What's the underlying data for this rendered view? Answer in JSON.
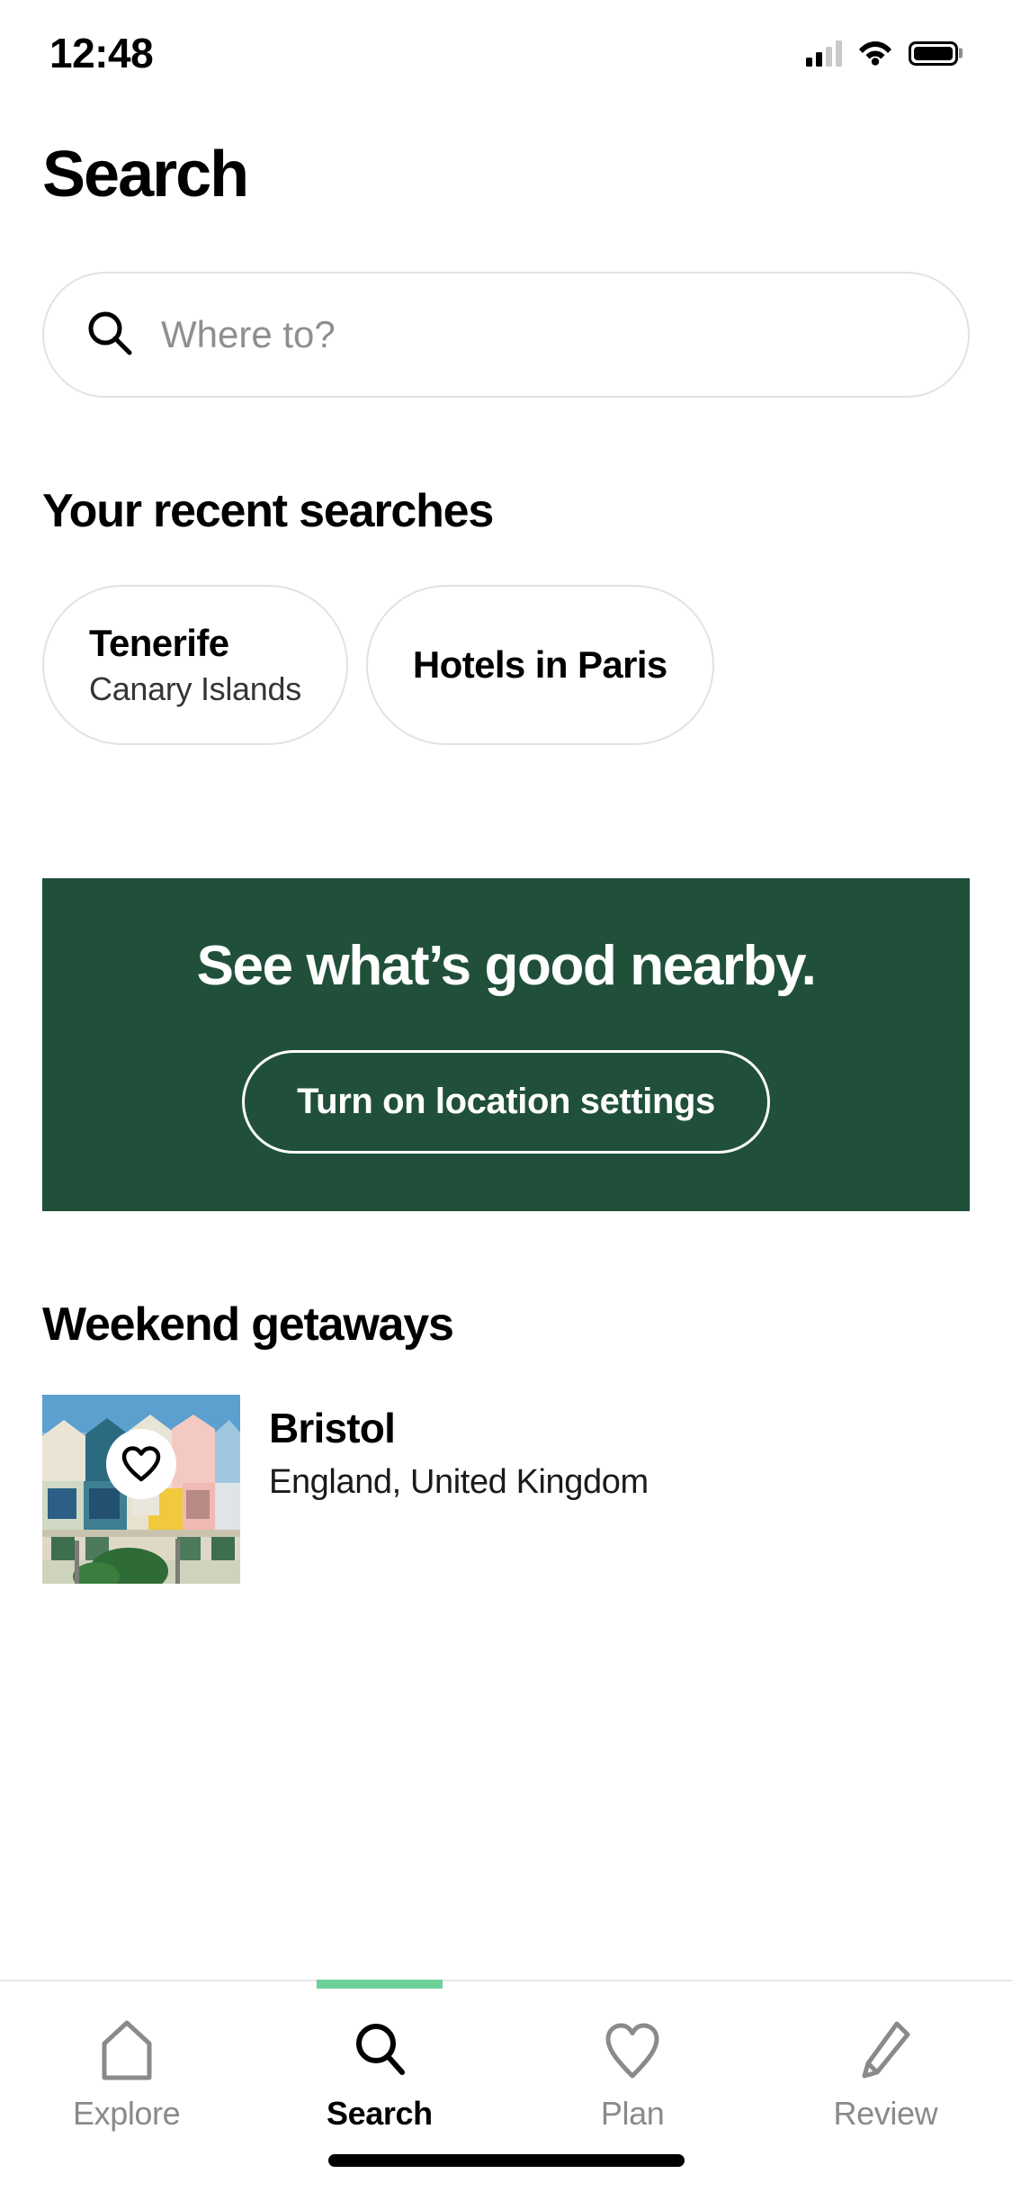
{
  "status_bar": {
    "time": "12:48",
    "cellular_icon": "signal-bars-icon",
    "wifi_icon": "wifi-icon",
    "battery_icon": "battery-full-icon"
  },
  "header": {
    "title": "Search"
  },
  "search": {
    "icon": "search-icon",
    "value": "",
    "placeholder": "Where to?"
  },
  "recent_searches": {
    "heading": "Your recent searches",
    "items": [
      {
        "title": "Tenerife",
        "subtitle": "Canary Islands"
      },
      {
        "title": "Hotels in Paris",
        "subtitle": ""
      }
    ]
  },
  "promo": {
    "title": "See what’s good nearby.",
    "button_label": "Turn on location settings",
    "background_color": "#20503A",
    "text_color": "#FFFFFF"
  },
  "weekend_getaways": {
    "heading": "Weekend getaways",
    "items": [
      {
        "name": "Bristol",
        "location": "England, United Kingdom",
        "favorite_icon": "heart-outline-icon",
        "image_alt": "colourful-terraced-houses-photo"
      }
    ]
  },
  "tab_bar": {
    "active_tab": "Search",
    "active_indicator_color": "#6FD19A",
    "tabs": [
      {
        "label": "Explore",
        "icon": "home-icon",
        "active": false
      },
      {
        "label": "Search",
        "icon": "search-icon",
        "active": true
      },
      {
        "label": "Plan",
        "icon": "heart-outline-icon",
        "active": false
      },
      {
        "label": "Review",
        "icon": "pencil-icon",
        "active": false
      }
    ]
  }
}
